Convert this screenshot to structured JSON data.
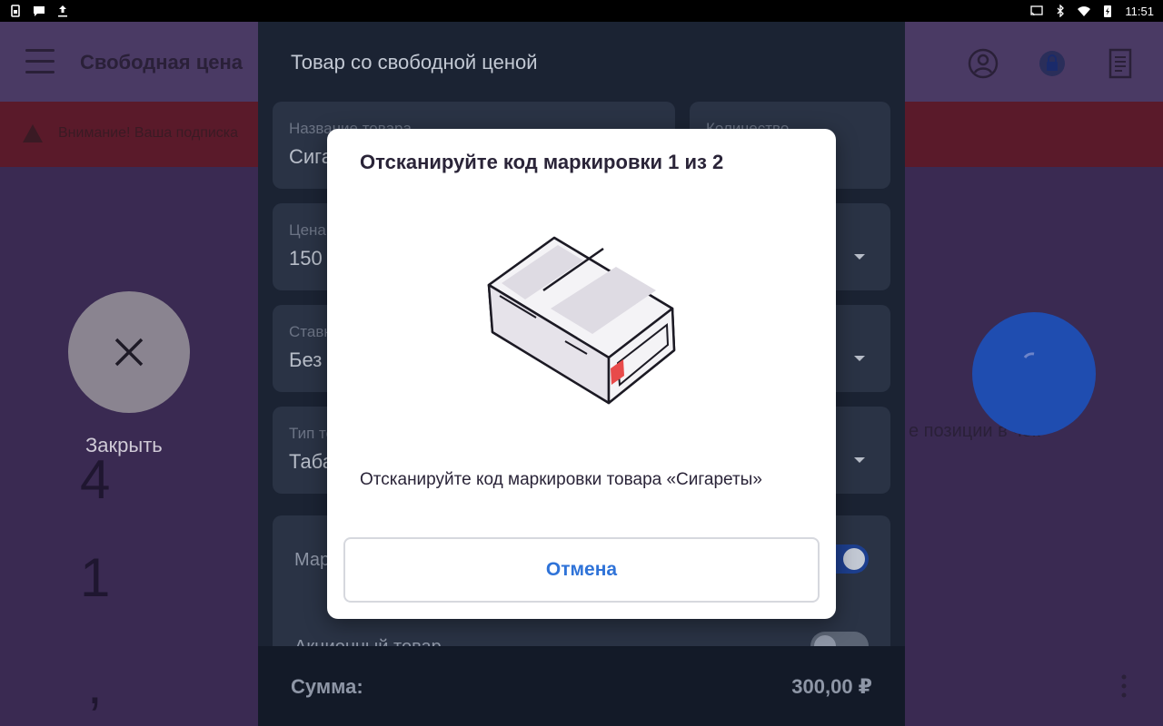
{
  "status_bar": {
    "time": "11:51",
    "left_icons": [
      "sim-card-icon",
      "chat-bubble-icon",
      "upload-icon"
    ],
    "right_icons": [
      "cast-icon",
      "bluetooth-icon",
      "wifi-icon",
      "battery-charging-icon"
    ]
  },
  "app": {
    "title": "Свободная цена",
    "warning_text": "Внимание! Ваша подписка",
    "close_label": "Закрыть",
    "keypad_digits": [
      "4",
      "1",
      ","
    ],
    "right_text": "е позиции в чек",
    "header_icons": [
      "account-icon",
      "lock-icon",
      "receipt-icon"
    ]
  },
  "panel": {
    "title": "Товар со свободной ценой",
    "fields": [
      {
        "label": "Название товара",
        "value": "Сигареты"
      },
      {
        "label": "Количество",
        "value": ""
      },
      {
        "label": "Цена",
        "value": "150"
      },
      {
        "label": "Ставка НДС",
        "value": "Без НДС"
      },
      {
        "label": "Тип товара",
        "value": "Табак"
      }
    ],
    "toggles": [
      {
        "label": "Маркированный товар",
        "on": true
      },
      {
        "label": "Акционный товар",
        "on": false
      }
    ],
    "sum_label": "Сумма:",
    "sum_value": "300,00 ₽"
  },
  "dialog": {
    "title": "Отсканируйте код маркировки 1 из 2",
    "message": "Отсканируйте код маркировки товара «Сигареты»",
    "cancel_label": "Отмена",
    "illustration": "cigarette-pack-icon"
  },
  "colors": {
    "accent": "#2f73d8",
    "fab": "#1f4db0",
    "marker_red": "#e84a4a"
  }
}
